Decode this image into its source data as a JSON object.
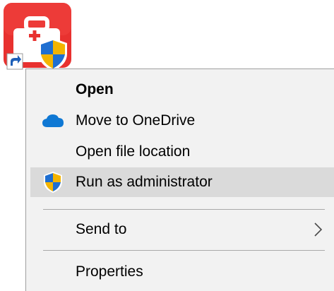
{
  "desktop": {
    "app_icon": "app-toolbox-shortcut-icon",
    "shortcut_overlay_icon": "shortcut-arrow-icon",
    "uac_overlay_icon": "uac-shield-icon"
  },
  "context_menu": {
    "items": [
      {
        "label": "Open",
        "bold": true,
        "icon": null
      },
      {
        "label": "Move to OneDrive",
        "bold": false,
        "icon": "onedrive-cloud-icon"
      },
      {
        "label": "Open file location",
        "bold": false,
        "icon": null
      },
      {
        "label": "Run as administrator",
        "bold": false,
        "icon": "uac-shield-icon",
        "highlighted": true
      },
      {
        "label": "Send to",
        "bold": false,
        "icon": null,
        "submenu": true,
        "submenu_icon": "chevron-right-icon"
      },
      {
        "label": "Properties",
        "bold": false,
        "icon": null
      }
    ]
  },
  "colors": {
    "menu_background": "#f2f2f2",
    "highlight": "#dadada",
    "separator": "#a9a9a9",
    "app_red": "#e8312f",
    "onedrive_blue": "#0f78d4"
  }
}
